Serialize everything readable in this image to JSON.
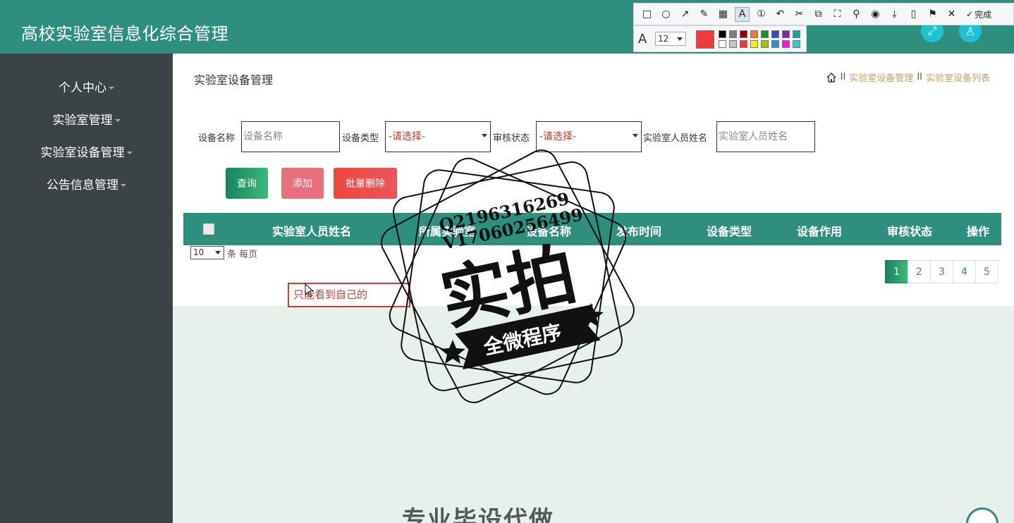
{
  "header": {
    "title": "高校实验室信息化综合管理",
    "fullscreen_icon": "expand-icon",
    "user_icon": "user-icon",
    "accent_color": "#2e8f7f"
  },
  "annotation_toolbar": {
    "done_label": "完成",
    "font_size": "12",
    "current_color": "#f13b3b",
    "swatches": [
      "#000000",
      "#7f7f7f",
      "#880015",
      "#ed7d31",
      "#22883a",
      "#3f48cc",
      "#7030a0",
      "#1f9ea0",
      "#ffffff",
      "#c3c3c3",
      "#e8383b",
      "#fff200",
      "#9bc31f",
      "#2f8fd9",
      "#e31fd1",
      "#33cccc"
    ]
  },
  "sidebar": {
    "items": [
      {
        "label": "个人中心"
      },
      {
        "label": "实验室管理"
      },
      {
        "label": "实验室设备管理"
      },
      {
        "label": "公告信息管理"
      }
    ]
  },
  "main": {
    "title": "实验室设备管理",
    "breadcrumb": [
      "实验室设备管理",
      "实验室设备列表"
    ],
    "breadcrumb_sep": "II",
    "filters": {
      "name_label": "设备名称",
      "name_placeholder": "设备名称",
      "type_label": "设备类型",
      "type_value": "-请选择-",
      "audit_label": "审核状态",
      "audit_value": "-请选择-",
      "person_label": "实验室人员姓名",
      "person_placeholder": "实验室人员姓名"
    },
    "buttons": {
      "query": "查询",
      "add": "添加",
      "bulk_delete": "批量删除"
    },
    "table": {
      "columns": [
        "实验室人员姓名",
        "所属实验室",
        "设备名称",
        "发布时间",
        "设备类型",
        "设备作用",
        "审核状态",
        "操作"
      ]
    },
    "per_page": {
      "value": "10",
      "suffix": "条 每页"
    },
    "pagination": [
      "1",
      "2",
      "3",
      "4",
      "5"
    ],
    "annotation_note": "只能看到自己的",
    "bottom_text": "专业毕设代做"
  },
  "watermark": {
    "line1": "Q2196316269",
    "line2": "V17060256499",
    "big": "实拍",
    "ribbon": "全微程序"
  }
}
